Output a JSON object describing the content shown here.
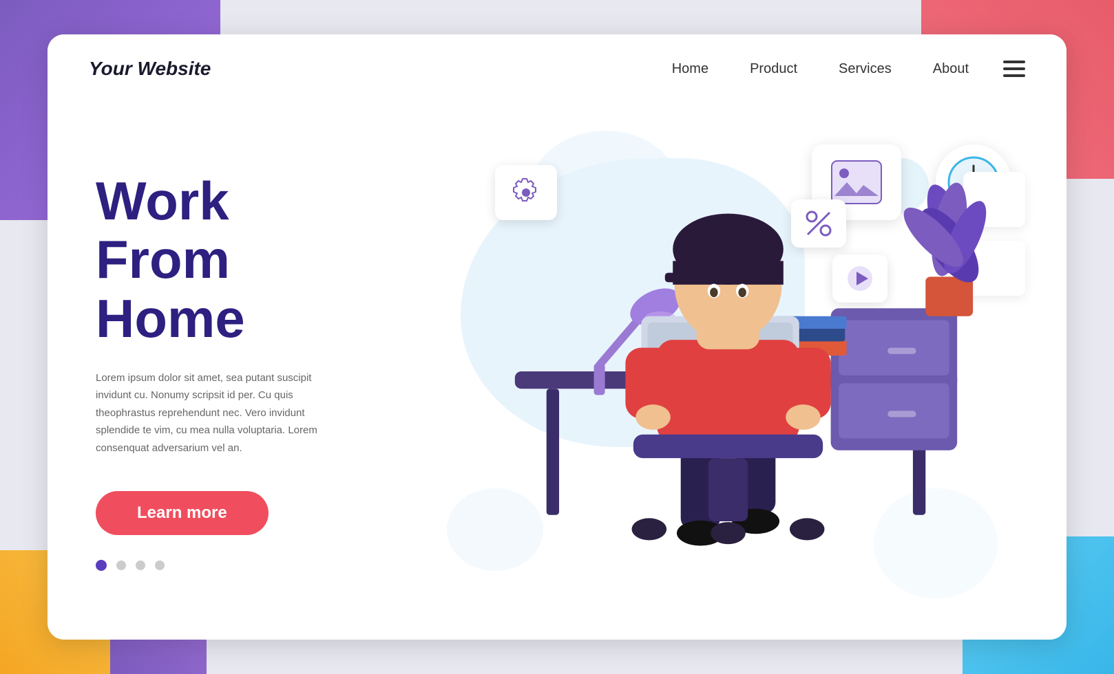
{
  "page": {
    "background_colors": {
      "corner_tl": "#7c5cbf",
      "corner_tr": "#e85c6a",
      "corner_bl_orange": "#f5a623",
      "corner_bl_purple": "#7c5cbf",
      "corner_br": "#38b6e8"
    }
  },
  "header": {
    "logo": "Your Website",
    "nav": {
      "home": "Home",
      "product": "Product",
      "services": "Services",
      "about": "About"
    },
    "hamburger_label": "menu"
  },
  "hero": {
    "title_line1": "Work",
    "title_line2": "From Home",
    "description": "Lorem ipsum dolor sit amet, sea putant suscipit invidunt cu. Nonumy scripsit id per. Cu quis theophrastus reprehendunt nec. Vero invidunt splendide te vim, cu mea nulla voluptaria. Lorem consenquat adversarium vel an.",
    "cta_button": "Learn more",
    "pagination_dots": [
      {
        "active": true
      },
      {
        "active": false
      },
      {
        "active": false
      },
      {
        "active": false
      }
    ]
  },
  "illustration": {
    "floating_gear_icon": "⚙",
    "floating_percent_icon": "%",
    "floating_play_icon": "▶",
    "floating_image_icon": "🖼",
    "floating_clock_label": "clock"
  }
}
